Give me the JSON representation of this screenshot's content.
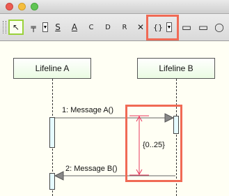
{
  "window": {
    "traffic_lights": [
      "close",
      "minimize",
      "zoom"
    ]
  },
  "toolbar": {
    "tools": [
      {
        "name": "select-tool-icon",
        "glyph": "↖"
      },
      {
        "name": "lifeline-tool-icon",
        "glyph": "╤"
      },
      {
        "name": "message-tool-icon",
        "glyph": "S"
      },
      {
        "name": "note-tool-icon",
        "glyph": "A"
      },
      {
        "name": "comment-tool-icon",
        "glyph": "C"
      },
      {
        "name": "destroy-tool-icon",
        "glyph": "D"
      },
      {
        "name": "reply-tool-icon",
        "glyph": "R"
      },
      {
        "name": "stop-tool-icon",
        "glyph": "✕"
      },
      {
        "name": "duration-constraint-tool-icon",
        "glyph": "{}"
      },
      {
        "name": "interaction-use-tool-icon",
        "glyph": "▭"
      },
      {
        "name": "combined-fragment-tool-icon",
        "glyph": "▭"
      },
      {
        "name": "ellipse-tool-icon",
        "glyph": "◯"
      }
    ]
  },
  "diagram": {
    "lifelines": [
      {
        "label": "Lifeline A"
      },
      {
        "label": "Lifeline B"
      }
    ],
    "messages": [
      {
        "label": "1: Message A()"
      },
      {
        "label": "2: Message B()"
      }
    ],
    "duration_constraint": "{0..25}"
  },
  "colors": {
    "highlight": "#f06a55",
    "constraint": "#e8345a",
    "canvas": "#fffff4",
    "selection": "#9ad23a"
  }
}
